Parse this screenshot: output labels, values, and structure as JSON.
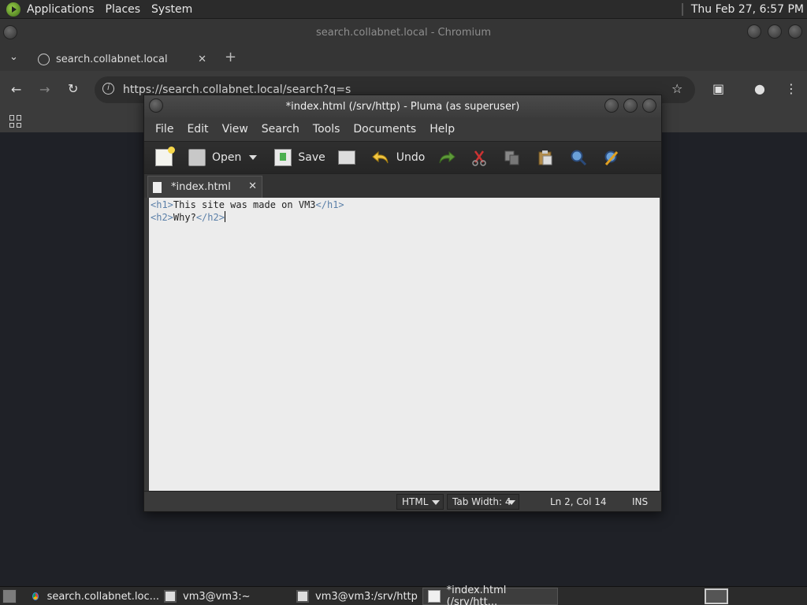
{
  "top_panel": {
    "menus": [
      "Applications",
      "Places",
      "System"
    ],
    "clock": "Thu Feb 27,  6:57 PM"
  },
  "chromium": {
    "window_title": "search.collabnet.local - Chromium",
    "tab_label": "search.collabnet.local",
    "url": "https://search.collabnet.local/search?q=s"
  },
  "pluma": {
    "window_title": "*index.html (/srv/http) - Pluma (as superuser)",
    "menu": [
      "File",
      "Edit",
      "View",
      "Search",
      "Tools",
      "Documents",
      "Help"
    ],
    "toolbar": {
      "open_label": "Open",
      "save_label": "Save",
      "undo_label": "Undo"
    },
    "doc_tab_label": "*index.html",
    "editor_lines": [
      {
        "open_tag": "<h1>",
        "text": "This site was made on VM3",
        "close_tag": "</h1>"
      },
      {
        "open_tag": "<h2>",
        "text": "Why?",
        "close_tag": "</h2>"
      }
    ],
    "status": {
      "language": "HTML",
      "tab_width": "Tab Width:  4",
      "position": "Ln 2, Col 14",
      "mode": "INS"
    }
  },
  "taskbar": {
    "items": [
      {
        "label": "search.collabnet.loc...",
        "icon": "chromium-icon"
      },
      {
        "label": "vm3@vm3:~",
        "icon": "terminal-icon"
      },
      {
        "label": "vm3@vm3:/srv/http",
        "icon": "terminal-icon"
      },
      {
        "label": "*index.html (/srv/htt...",
        "icon": "text-editor-icon"
      }
    ]
  },
  "colors": {
    "editor_bg": "#ececec",
    "tag_color": "#5a7fa8",
    "panel_bg": "#2b2b2b"
  }
}
